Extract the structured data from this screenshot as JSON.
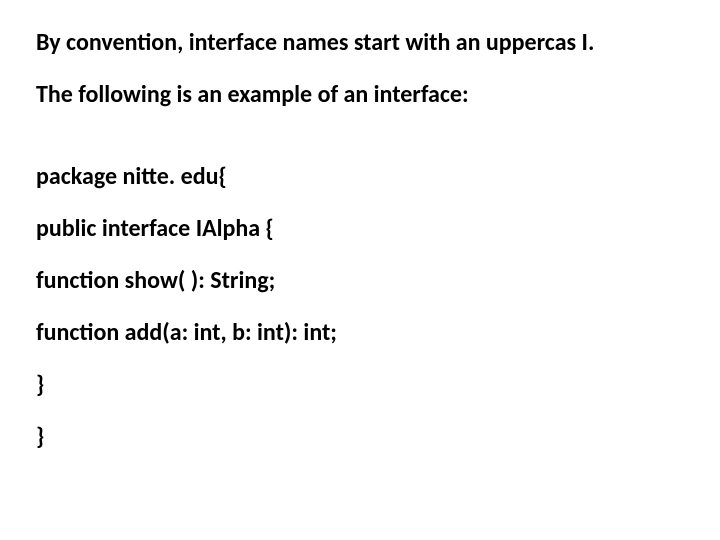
{
  "lines": {
    "l1": "By convention, interface names start with an uppercas I.",
    "l2": "The following is an example of an interface:",
    "l3": "package nitte. edu{",
    "l4": "public interface IAlpha {",
    "l5": "function show( ): String;",
    "l6": "function add(a: int, b: int): int;",
    "l7": "}",
    "l8": "}"
  }
}
